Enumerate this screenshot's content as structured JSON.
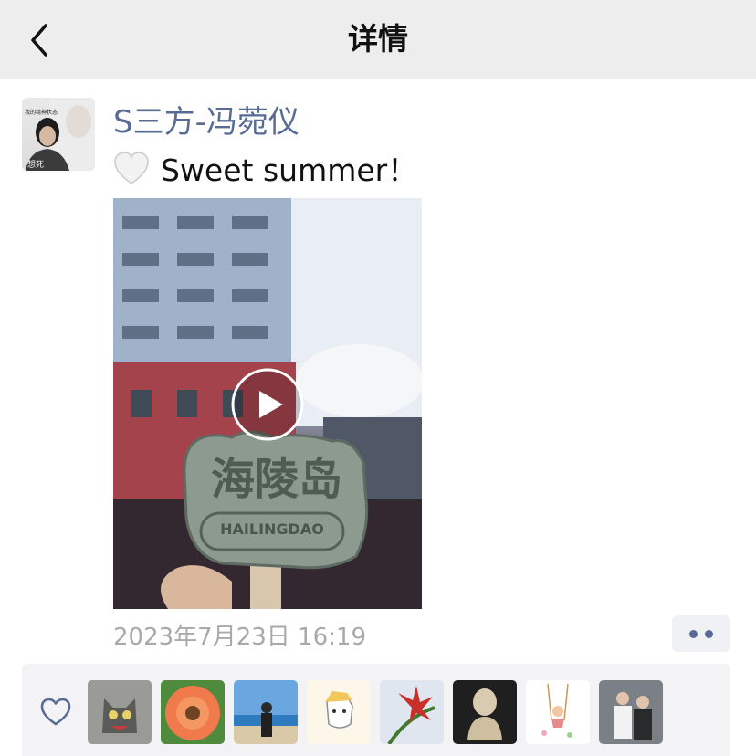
{
  "nav": {
    "title": "详情",
    "back_icon": "chevron-left-icon"
  },
  "post": {
    "author": "S三方-冯菀仪",
    "text": "Sweet summer！",
    "text_emoji": "white-heart-emoji",
    "avatar_caption_top": "我的精神状态",
    "avatar_caption_bottom": "想死",
    "video": {
      "sign_text": "海陵岛",
      "sign_subtext": "HAILINGDAO",
      "play_icon": "play-circle-icon"
    },
    "timestamp": "2023年7月23日 16:19",
    "more_icon": "more-dots-icon"
  },
  "likes": {
    "icon": "heart-outline-icon",
    "users": [
      {
        "avatar": "gray-cat-avatar"
      },
      {
        "avatar": "orange-gerbera-flower-avatar"
      },
      {
        "avatar": "beach-person-avatar"
      },
      {
        "avatar": "cartoon-character-avatar"
      },
      {
        "avatar": "red-lily-flower-avatar"
      },
      {
        "avatar": "buddha-figurine-avatar"
      },
      {
        "avatar": "swing-illustration-avatar"
      },
      {
        "avatar": "couple-photo-avatar"
      }
    ]
  },
  "colors": {
    "nav_background": "#ededed",
    "author_name": "#576b95",
    "timestamp": "#a9a9a9",
    "likes_background": "#f3f3f5"
  }
}
